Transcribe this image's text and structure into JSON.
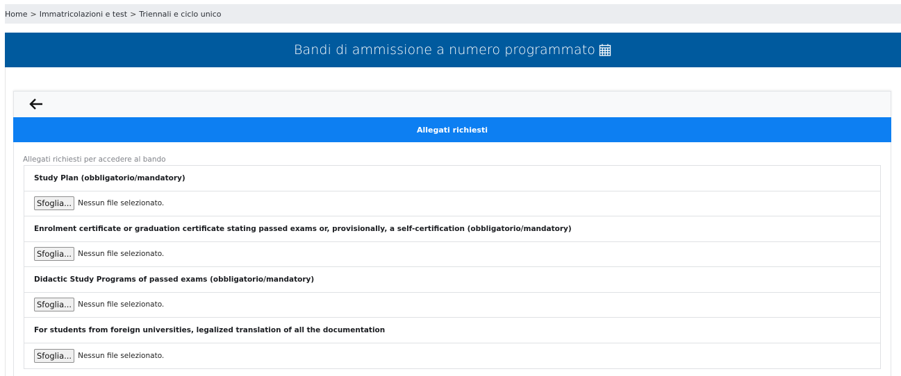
{
  "breadcrumb": {
    "items": [
      "Home",
      "Immatricolazioni e test",
      "Triennali e ciclo unico"
    ],
    "separator": ">"
  },
  "header": {
    "title": "Bandi di ammissione a numero programmato",
    "icon": "calendar-icon",
    "background": "#005a9e"
  },
  "back_button": {
    "icon": "arrow-left-icon"
  },
  "section": {
    "title": "Allegati richiesti",
    "background": "#0d7ff2"
  },
  "attachments": {
    "intro": "Allegati richiesti per accedere al bando",
    "items": [
      {
        "title": "Study Plan (obbligatorio/mandatory)",
        "button_label": "Sfoglia...",
        "status": "Nessun file selezionato."
      },
      {
        "title": "Enrolment certificate or graduation certificate stating passed exams or, provisionally, a self-certification  (obbligatorio/mandatory)",
        "button_label": "Sfoglia...",
        "status": "Nessun file selezionato."
      },
      {
        "title": "Didactic Study Programs of passed exams (obbligatorio/mandatory)",
        "button_label": "Sfoglia...",
        "status": "Nessun file selezionato."
      },
      {
        "title": "For students from foreign universities, legalized translation of all the documentation",
        "button_label": "Sfoglia...",
        "status": "Nessun file selezionato."
      }
    ]
  }
}
